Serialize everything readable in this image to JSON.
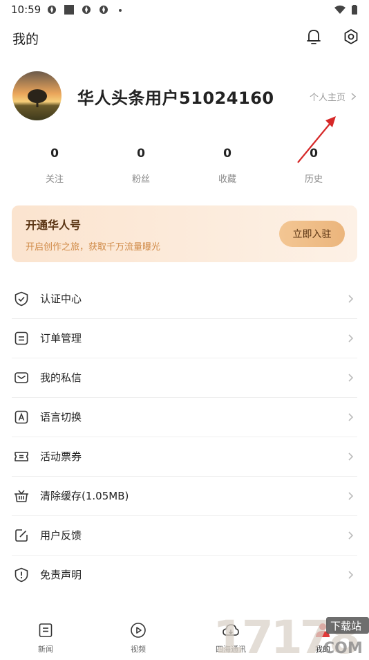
{
  "status_bar": {
    "time": "10:59"
  },
  "header": {
    "title": "我的"
  },
  "profile": {
    "username": "华人头条用户51024160",
    "profile_link": "个人主页"
  },
  "stats": [
    {
      "value": "0",
      "label": "关注"
    },
    {
      "value": "0",
      "label": "粉丝"
    },
    {
      "value": "0",
      "label": "收藏"
    },
    {
      "value": "0",
      "label": "历史"
    }
  ],
  "banner": {
    "title": "开通华人号",
    "subtitle": "开启创作之旅，获取千万流量曝光",
    "button": "立即入驻"
  },
  "menu": [
    {
      "label": "认证中心",
      "icon": "shield-check-icon"
    },
    {
      "label": "订单管理",
      "icon": "order-icon"
    },
    {
      "label": "我的私信",
      "icon": "mail-icon"
    },
    {
      "label": "语言切换",
      "icon": "language-icon"
    },
    {
      "label": "活动票券",
      "icon": "ticket-icon"
    },
    {
      "label": "清除缓存(1.05MB)",
      "icon": "basket-icon"
    },
    {
      "label": "用户反馈",
      "icon": "feedback-icon"
    },
    {
      "label": "免责声明",
      "icon": "disclaimer-icon"
    }
  ],
  "bottom_nav": [
    {
      "label": "新闻",
      "icon": "news-icon"
    },
    {
      "label": "视频",
      "icon": "play-icon"
    },
    {
      "label": "四海通讯",
      "icon": "cloud-icon"
    },
    {
      "label": "我的",
      "icon": "user-icon"
    }
  ],
  "watermark": {
    "text": "17178",
    "sub_top": "下载站",
    "sub_bottom": "COM"
  },
  "colors": {
    "accent_text": "#5a3413",
    "banner_sub": "#d08a47",
    "arrow": "#d62828"
  }
}
